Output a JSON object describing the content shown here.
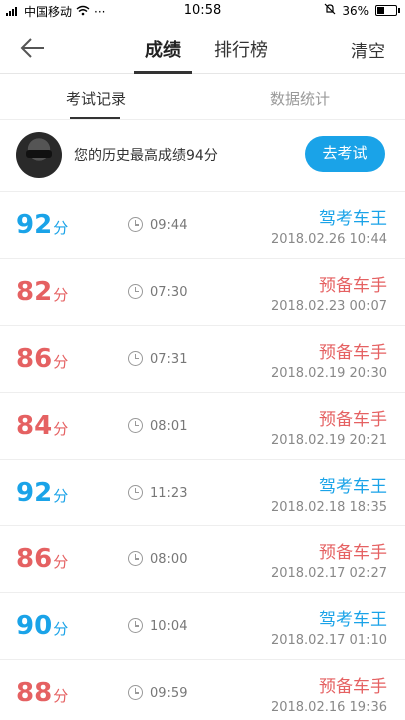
{
  "status_bar": {
    "carrier": "中国移动",
    "more": "···",
    "time": "10:58",
    "battery": "36%",
    "battery_level": 0.36
  },
  "header": {
    "tabs": [
      "成绩",
      "排行榜"
    ],
    "active_tab": 0,
    "clear_label": "清空"
  },
  "subtabs": {
    "items": [
      "考试记录",
      "数据统计"
    ],
    "active": 0
  },
  "best": {
    "text": "您的历史最高成绩94分",
    "button_label": "去考试"
  },
  "unit": "分",
  "colors": {
    "accent_blue": "#1aa3e8",
    "accent_red": "#e56162"
  },
  "records": [
    {
      "score": "92",
      "duration": "09:44",
      "title": "驾考车王",
      "date": "2018.02.26  10:44",
      "tone": "blue"
    },
    {
      "score": "82",
      "duration": "07:30",
      "title": "预备车手",
      "date": "2018.02.23  00:07",
      "tone": "red"
    },
    {
      "score": "86",
      "duration": "07:31",
      "title": "预备车手",
      "date": "2018.02.19  20:30",
      "tone": "red"
    },
    {
      "score": "84",
      "duration": "08:01",
      "title": "预备车手",
      "date": "2018.02.19  20:21",
      "tone": "red"
    },
    {
      "score": "92",
      "duration": "11:23",
      "title": "驾考车王",
      "date": "2018.02.18  18:35",
      "tone": "blue"
    },
    {
      "score": "86",
      "duration": "08:00",
      "title": "预备车手",
      "date": "2018.02.17  02:27",
      "tone": "red"
    },
    {
      "score": "90",
      "duration": "10:04",
      "title": "驾考车王",
      "date": "2018.02.17  01:10",
      "tone": "blue"
    },
    {
      "score": "88",
      "duration": "09:59",
      "title": "预备车手",
      "date": "2018.02.16  19:36",
      "tone": "red"
    }
  ]
}
